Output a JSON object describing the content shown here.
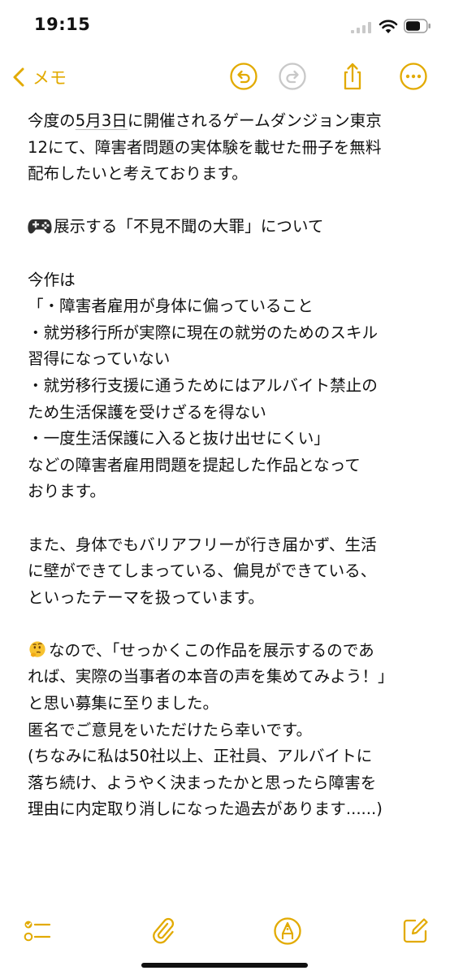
{
  "status": {
    "time": "19:15"
  },
  "nav": {
    "back_label": "メモ"
  },
  "note": {
    "line1_pre": "今度の",
    "line1_date": "5月3日",
    "line1_post": "に開催されるゲームダンジョン東京",
    "line2": "12にて、障害者問題の実体験を載せた冊子を無料",
    "line3": "配布したいと考えております。",
    "line4": "展示する「不見不聞の大罪」について",
    "line5": "今作は",
    "line6": "「・障害者雇用が身体に偏っていること",
    "line7": "・就労移行所が実際に現在の就労のためのスキル",
    "line8": "習得になっていない",
    "line9": "・就労移行支援に通うためにはアルバイト禁止の",
    "line10": "ため生活保護を受けざるを得ない",
    "line11": "・一度生活保護に入ると抜け出せにくい」",
    "line12": "などの障害者雇用問題を提起した作品となって",
    "line13": "おります。",
    "line14": "また、身体でもバリアフリーが行き届かず、生活",
    "line15": "に壁ができてしまっている、偏見ができている、",
    "line16": "といったテーマを扱っています。",
    "line17": "なので、「せっかくこの作品を展示するのであ",
    "line18": "れば、実際の当事者の本音の声を集めてみよう！」",
    "line19": "と思い募集に至りました。",
    "line20": "匿名でご意見をいただけたら幸いです。",
    "line21": "(ちなみに私は50社以上、正社員、アルバイトに",
    "line22": "落ち続け、ようやく決まったかと思ったら障害を",
    "line23": "理由に内定取り消しになった過去があります......)"
  },
  "colors": {
    "accent": "#e2aa00",
    "disabled": "#c8c8c8",
    "text": "#111111"
  },
  "icons": {
    "undo": "undo-icon",
    "redo": "redo-icon",
    "share": "share-icon",
    "more": "more-icon",
    "checklist": "checklist-icon",
    "attach": "paperclip-icon",
    "markup": "markup-pen-icon",
    "compose": "compose-icon",
    "gamepad": "gamepad-emoji",
    "thinking": "thinking-face-emoji"
  }
}
